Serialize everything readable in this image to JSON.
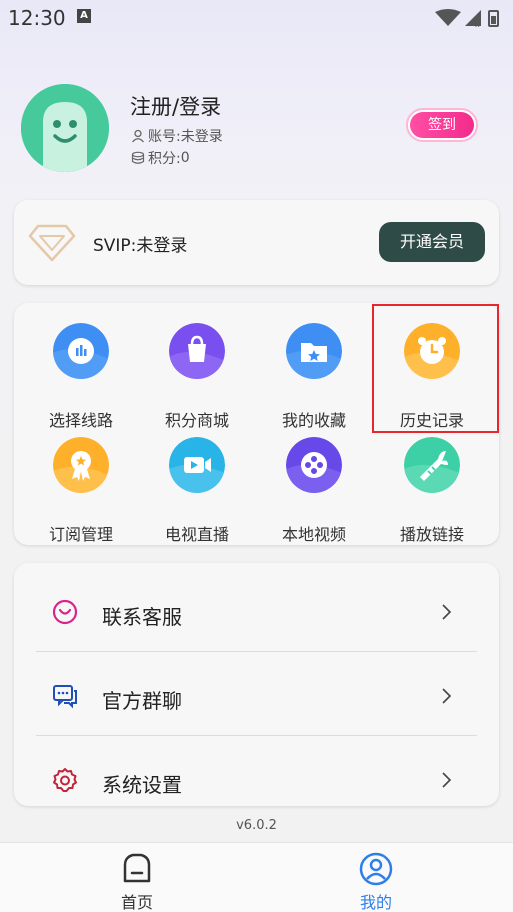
{
  "status_bar": {
    "time": "12:30",
    "badge_letter": "A"
  },
  "profile": {
    "username": "注册/登录",
    "account_label": "账号:",
    "account_value": "未登录",
    "points_label": "积分:",
    "points_value": "0",
    "checkin_label": "签到"
  },
  "svip": {
    "status_text": "SVIP:未登录",
    "open_button": "开通会员"
  },
  "features": [
    {
      "label": "选择线路",
      "icon": "route-icon",
      "color": "#3d8ff5"
    },
    {
      "label": "积分商城",
      "icon": "shopping-bag-icon",
      "color": "#7a4ff0"
    },
    {
      "label": "我的收藏",
      "icon": "folder-star-icon",
      "color": "#3d8ff5"
    },
    {
      "label": "历史记录",
      "icon": "alarm-clock-icon",
      "color": "#ffb22e"
    },
    {
      "label": "订阅管理",
      "icon": "award-icon",
      "color": "#ffb22e"
    },
    {
      "label": "电视直播",
      "icon": "video-camera-icon",
      "color": "#2ab6e8"
    },
    {
      "label": "本地视频",
      "icon": "film-reel-icon",
      "color": "#6a49ea"
    },
    {
      "label": "播放链接",
      "icon": "carrot-icon",
      "color": "#3fd1a8"
    }
  ],
  "menu": [
    {
      "label": "联系客服",
      "icon": "customer-service-icon"
    },
    {
      "label": "官方群聊",
      "icon": "group-chat-icon"
    },
    {
      "label": "系统设置",
      "icon": "gear-icon"
    }
  ],
  "version": "v6.0.2",
  "bottom_nav": {
    "home_label": "首页",
    "mine_label": "我的",
    "active_color": "#2f7fe8",
    "inactive_color": "#333333"
  }
}
